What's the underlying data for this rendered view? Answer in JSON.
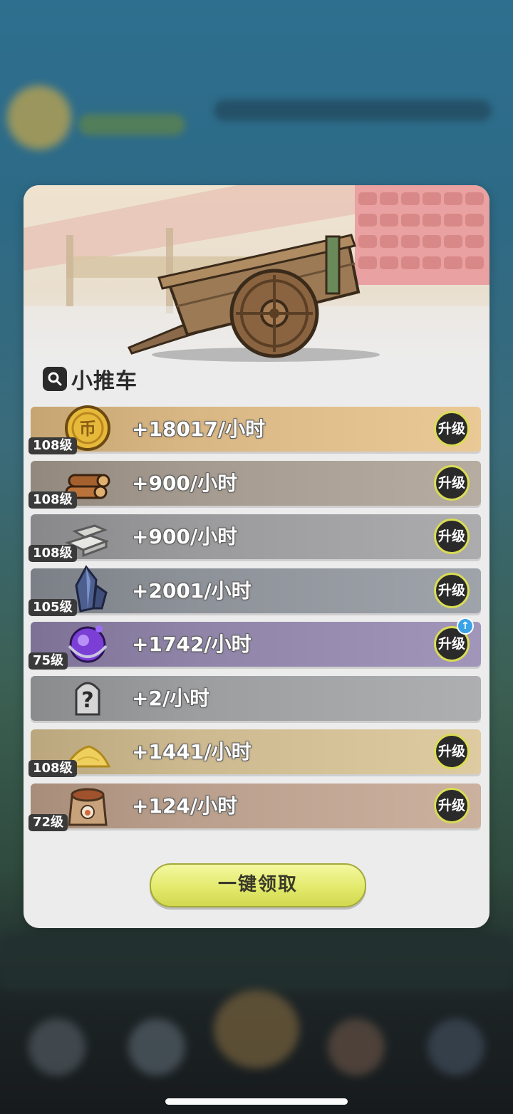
{
  "popup": {
    "title": "小推车",
    "claim_button": "一键领取",
    "upgrade_label": "升级",
    "rows": [
      {
        "level": "108级",
        "rate": "+18017/小时",
        "icon": "gold-coin-icon",
        "bg": "#d9b784",
        "upgrade": true,
        "badge": false
      },
      {
        "level": "108级",
        "rate": "+900/小时",
        "icon": "wood-logs-icon",
        "bg": "#a49a8f",
        "upgrade": true,
        "badge": false
      },
      {
        "level": "108级",
        "rate": "+900/小时",
        "icon": "stone-bricks-icon",
        "bg": "#9a9a9c",
        "upgrade": true,
        "badge": false
      },
      {
        "level": "105级",
        "rate": "+2001/小时",
        "icon": "crystal-ore-icon",
        "bg": "#8d9198",
        "upgrade": true,
        "badge": false
      },
      {
        "level": "75级",
        "rate": "+1742/小时",
        "icon": "magic-orb-icon",
        "bg": "#8f84a8",
        "upgrade": true,
        "badge": true
      },
      {
        "level": "",
        "rate": "+2/小时",
        "icon": "unknown-item-icon",
        "bg": "#9c9d9f",
        "upgrade": false,
        "badge": false
      },
      {
        "level": "108级",
        "rate": "+1441/小时",
        "icon": "sand-pile-icon",
        "bg": "#cdb98f",
        "upgrade": true,
        "badge": false
      },
      {
        "level": "72级",
        "rate": "+124/小时",
        "icon": "food-sack-icon",
        "bg": "#b99f8c",
        "upgrade": true,
        "badge": false
      }
    ]
  }
}
